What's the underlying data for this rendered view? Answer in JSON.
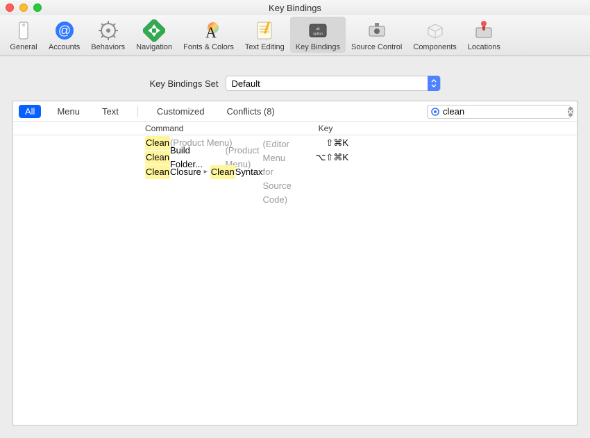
{
  "window_title": "Key Bindings",
  "toolbar": [
    {
      "id": "general",
      "label": "General",
      "active": false
    },
    {
      "id": "accounts",
      "label": "Accounts",
      "active": false
    },
    {
      "id": "behaviors",
      "label": "Behaviors",
      "active": false
    },
    {
      "id": "navigation",
      "label": "Navigation",
      "active": false
    },
    {
      "id": "fonts-colors",
      "label": "Fonts & Colors",
      "active": false
    },
    {
      "id": "text-editing",
      "label": "Text Editing",
      "active": false
    },
    {
      "id": "key-bindings",
      "label": "Key Bindings",
      "active": true
    },
    {
      "id": "source-control",
      "label": "Source Control",
      "active": false
    },
    {
      "id": "components",
      "label": "Components",
      "active": false
    },
    {
      "id": "locations",
      "label": "Locations",
      "active": false
    }
  ],
  "set_label": "Key Bindings Set",
  "set_value": "Default",
  "filters": {
    "all": "All",
    "menu": "Menu",
    "text": "Text",
    "customized": "Customized",
    "conflicts": "Conflicts (8)"
  },
  "search": {
    "value": "clean",
    "placeholder": ""
  },
  "columns": {
    "command": "Command",
    "key": "Key"
  },
  "rows": [
    {
      "parts": [
        {
          "text": "Clean",
          "hl": true
        },
        {
          "text": " ",
          "hl": false
        },
        {
          "text": "(Product Menu)",
          "hl": false,
          "hint": true
        }
      ],
      "key": "⇧⌘K"
    },
    {
      "parts": [
        {
          "text": "Clean",
          "hl": true
        },
        {
          "text": " Build Folder... ",
          "hl": false
        },
        {
          "text": "(Product Menu)",
          "hl": false,
          "hint": true
        }
      ],
      "key": "⌥⇧⌘K"
    },
    {
      "parts": [
        {
          "text": "Clean",
          "hl": true
        },
        {
          "text": " Closure",
          "hl": false
        },
        {
          "sep": true
        },
        {
          "text": "Clean",
          "hl": true
        },
        {
          "text": " Syntax ",
          "hl": false
        },
        {
          "text": "(Editor Menu for Source Code)",
          "hl": false,
          "hint": true
        }
      ],
      "key": ""
    }
  ]
}
